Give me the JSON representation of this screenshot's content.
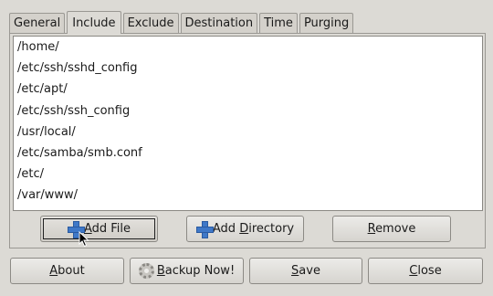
{
  "tabs": [
    {
      "label": "General",
      "active": false
    },
    {
      "label": "Include",
      "active": true
    },
    {
      "label": "Exclude",
      "active": false
    },
    {
      "label": "Destination",
      "active": false
    },
    {
      "label": "Time",
      "active": false
    },
    {
      "label": "Purging",
      "active": false
    }
  ],
  "include_list": [
    "/home/",
    "/etc/ssh/sshd_config",
    "/etc/apt/",
    "/etc/ssh/ssh_config",
    "/usr/local/",
    "/etc/samba/smb.conf",
    "/etc/",
    "/var/www/"
  ],
  "list_actions": {
    "add_file": {
      "pre": "",
      "mnemonic": "A",
      "post": "dd File",
      "icon": "plus-icon"
    },
    "add_directory": {
      "pre": "Add ",
      "mnemonic": "D",
      "post": "irectory",
      "icon": "plus-icon"
    },
    "remove": {
      "pre": "",
      "mnemonic": "R",
      "post": "emove"
    }
  },
  "footer": {
    "about": {
      "pre": "",
      "mnemonic": "A",
      "post": "bout"
    },
    "backup_now": {
      "pre": "",
      "mnemonic": "B",
      "post": "ackup Now!",
      "icon": "gear-icon"
    },
    "save": {
      "pre": "",
      "mnemonic": "S",
      "post": "ave"
    },
    "close": {
      "pre": "",
      "mnemonic": "C",
      "post": "lose"
    }
  }
}
